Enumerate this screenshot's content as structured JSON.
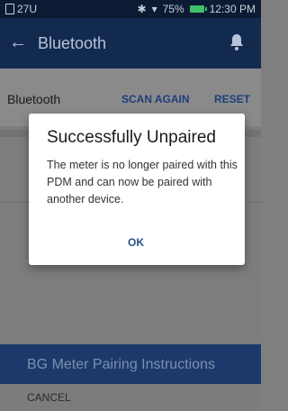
{
  "status": {
    "left": "27U",
    "battery": "75%",
    "time": "12:30 PM"
  },
  "header": {
    "title": "Bluetooth",
    "back_icon": "arrow-left-icon",
    "bell_icon": "bell-icon"
  },
  "bluetooth_row": {
    "label": "Bluetooth",
    "scan_again": "SCAN AGAIN",
    "reset": "RESET"
  },
  "dialog": {
    "title": "Successfully Unpaired",
    "message": "The meter is no longer paired with this PDM and can now be paired with another device.",
    "ok": "OK"
  },
  "instructions": {
    "label": "BG Meter Pairing Instructions"
  },
  "footer": {
    "cancel": "CANCEL"
  },
  "colors": {
    "header_bg": "#132a4f",
    "accent": "#2a4f8a",
    "instructions_bg": "#1b3a6b"
  }
}
